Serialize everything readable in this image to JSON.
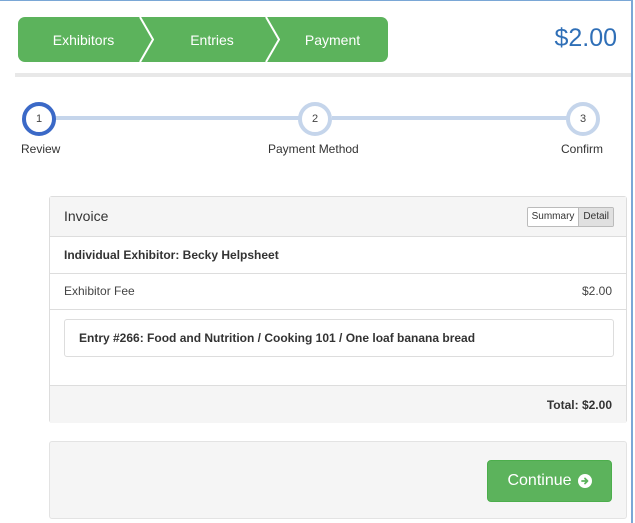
{
  "breadcrumb": {
    "steps": [
      {
        "label": "Exhibitors"
      },
      {
        "label": "Entries"
      },
      {
        "label": "Payment"
      }
    ]
  },
  "header": {
    "price": "$2.00"
  },
  "stepper": {
    "steps": [
      {
        "number": "1",
        "label": "Review",
        "state": "active"
      },
      {
        "number": "2",
        "label": "Payment Method",
        "state": "pending"
      },
      {
        "number": "3",
        "label": "Confirm",
        "state": "pending"
      }
    ]
  },
  "invoice": {
    "title": "Invoice",
    "view_toggle": {
      "options": [
        "Summary",
        "Detail"
      ],
      "selected": "Detail"
    },
    "exhibitor": "Individual Exhibitor: Becky Helpsheet",
    "fee": {
      "label": "Exhibitor Fee",
      "amount": "$2.00"
    },
    "entry": "Entry #266: Food and Nutrition / Cooking 101 / One loaf banana bread",
    "total": "Total: $2.00"
  },
  "actions": {
    "continue_label": "Continue"
  },
  "colors": {
    "accent_green": "#5cb35c",
    "price_blue": "#2f6fb7",
    "active_step": "#3b69c7",
    "step_track": "#c5d5eb"
  },
  "icons": {
    "continue": "circle-arrow-right-icon"
  }
}
